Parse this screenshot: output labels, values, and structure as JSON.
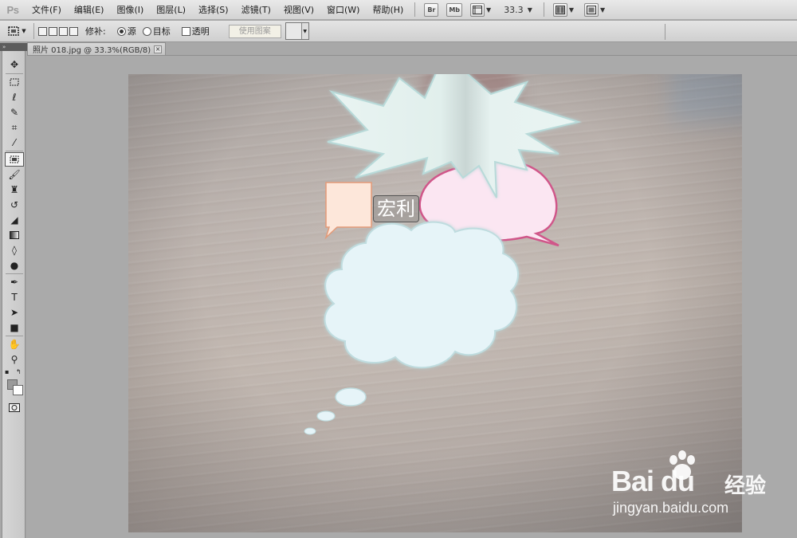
{
  "app": {
    "logo": "Ps",
    "menu": [
      "文件(F)",
      "编辑(E)",
      "图像(I)",
      "图层(L)",
      "选择(S)",
      "滤镜(T)",
      "视图(V)",
      "窗口(W)",
      "帮助(H)"
    ],
    "menubar_buttons": [
      "Br",
      "Mb"
    ],
    "zoom": "33.3"
  },
  "options": {
    "repair_label": "修补:",
    "source_label": "源",
    "target_label": "目标",
    "transparent_label": "透明",
    "use_pattern_label": "使用图案"
  },
  "document": {
    "tab_title": "照片 018.jpg @ 33.3%(RGB/8)",
    "close": "×"
  },
  "canvas": {
    "overlay_text": "宏利",
    "colors": {
      "burst_fill": "#e3f1ef",
      "square_fill": "#fde7da",
      "oval_fill": "#fbe6f2",
      "oval_stroke": "#d0578a",
      "cloud_fill": "#e6f4f8"
    }
  },
  "watermark": {
    "brand": "Bai du",
    "jingyan": "经验",
    "url": "jingyan.baidu.com"
  },
  "toolbar_icons": [
    "move-icon",
    "marquee-icon",
    "lasso-icon",
    "quick-selection-icon",
    "crop-icon",
    "eyedropper-icon",
    "patch-icon",
    "brush-icon",
    "clone-stamp-icon",
    "history-brush-icon",
    "eraser-icon",
    "gradient-icon",
    "blur-icon",
    "dodge-icon",
    "pen-icon",
    "type-icon",
    "path-selection-icon",
    "rectangle-icon",
    "hand-icon",
    "zoom-icon",
    "quick-mask-icon"
  ]
}
